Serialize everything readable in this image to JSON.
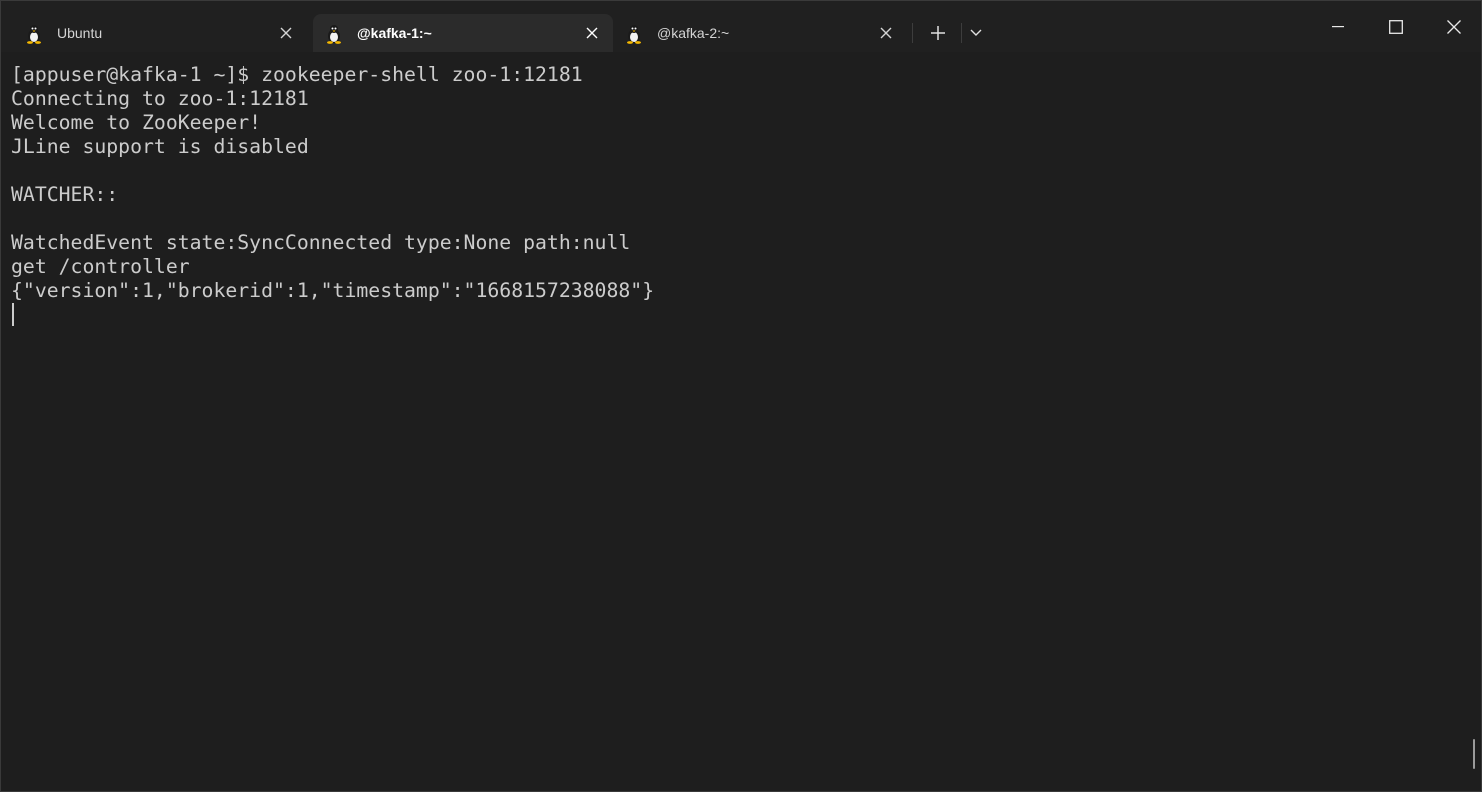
{
  "tabs": [
    {
      "title": "Ubuntu",
      "icon": "linux-tux-icon",
      "active": false
    },
    {
      "title": "@kafka-1:~",
      "icon": "linux-tux-icon",
      "active": true
    },
    {
      "title": "@kafka-2:~",
      "icon": "linux-tux-icon",
      "active": false
    }
  ],
  "toolbar": {
    "new_tab_icon": "plus-icon",
    "dropdown_icon": "chevron-down-icon"
  },
  "window_controls": {
    "minimize_icon": "minimize-icon",
    "maximize_icon": "maximize-icon",
    "close_icon": "close-icon"
  },
  "terminal": {
    "lines": [
      "[appuser@kafka-1 ~]$ zookeeper-shell zoo-1:12181",
      "Connecting to zoo-1:12181",
      "Welcome to ZooKeeper!",
      "JLine support is disabled",
      "",
      "WATCHER::",
      "",
      "WatchedEvent state:SyncConnected type:None path:null",
      "get /controller",
      "{\"version\":1,\"brokerid\":1,\"timestamp\":\"1668157238088\"}"
    ]
  },
  "colors": {
    "terminal_bg": "#1e1e1e",
    "titlebar_bg": "#202020",
    "active_tab_bg": "#2b2b2b",
    "text": "#cccccc"
  }
}
